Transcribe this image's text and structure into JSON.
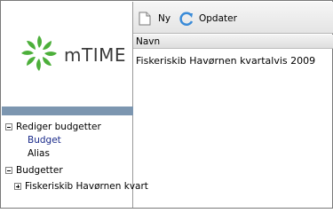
{
  "toolbar": {
    "new_label": "Ny",
    "refresh_label": "Opdater"
  },
  "logo": {
    "text": "mTIME"
  },
  "tree": {
    "section1": {
      "label": "Rediger budgetter",
      "children": [
        "Budget",
        "Alias"
      ]
    },
    "section2": {
      "label": "Budgetter",
      "children": [
        "Fiskeriskib Havørnen kvart"
      ]
    }
  },
  "table": {
    "headers": [
      "Navn"
    ],
    "rows": [
      [
        "Fiskeriskib Havørnen kvartalvis 2009"
      ]
    ]
  },
  "colors": {
    "logo_green": "#4caf3a",
    "band": "#7c96b0"
  }
}
